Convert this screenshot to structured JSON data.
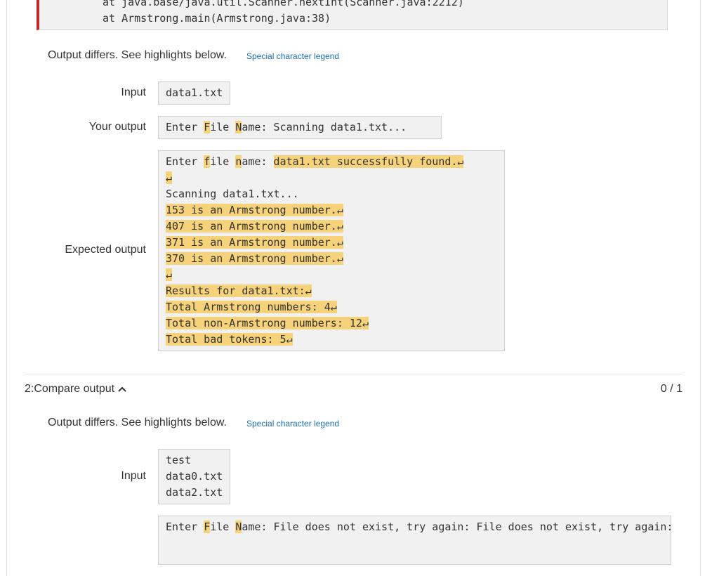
{
  "trace": {
    "line1": "at java.base/java.util.Scanner.nextInt(Scanner.java:2212)",
    "line2": "at Armstrong.main(Armstrong.java:38)"
  },
  "test1": {
    "message": "Output differs. See highlights below.",
    "legend_link": "Special character legend",
    "input_label": "Input",
    "input_value": "data1.txt",
    "your_output_label": "Your output",
    "your_output": {
      "seg1": "Enter ",
      "seg2": "F",
      "seg3": "ile ",
      "seg4": "N",
      "seg5": "ame: Scanning data1.txt..."
    },
    "expected_label": "Expected output",
    "expected": {
      "l1_a": "Enter ",
      "l1_b": "f",
      "l1_c": "ile ",
      "l1_d": "n",
      "l1_e": "ame: ",
      "l1_f": "data1.txt successfully found.↵",
      "l2": "↵",
      "l3": "Scanning data1.txt...",
      "l4": "153 is an Armstrong number.↵",
      "l5": "407 is an Armstrong number.↵",
      "l6": "371 is an Armstrong number.↵",
      "l7": "370 is an Armstrong number.↵",
      "l8": "↵",
      "l9": "Results for data1.txt:↵",
      "l10": "Total Armstrong numbers: 4↵",
      "l11": "Total non-Armstrong numbers: 12↵",
      "l12": "Total bad tokens: 5↵"
    }
  },
  "section2": {
    "title": "2:Compare output",
    "score": "0 / 1",
    "message": "Output differs. See highlights below.",
    "legend_link": "Special character legend",
    "input_label": "Input",
    "input_lines": [
      "test",
      "data0.txt",
      "data2.txt"
    ],
    "output": {
      "seg1": "Enter ",
      "seg2": "F",
      "seg3": "ile ",
      "seg4": "N",
      "seg5": "ame: File does not exist, try again: File does not exist, try again: File does not exist"
    }
  },
  "colors": {
    "highlight": "#f6d27a",
    "error_bar": "#c62828",
    "link": "#1a6fb3"
  },
  "icons": {
    "collapse": "chevron-up-icon"
  }
}
